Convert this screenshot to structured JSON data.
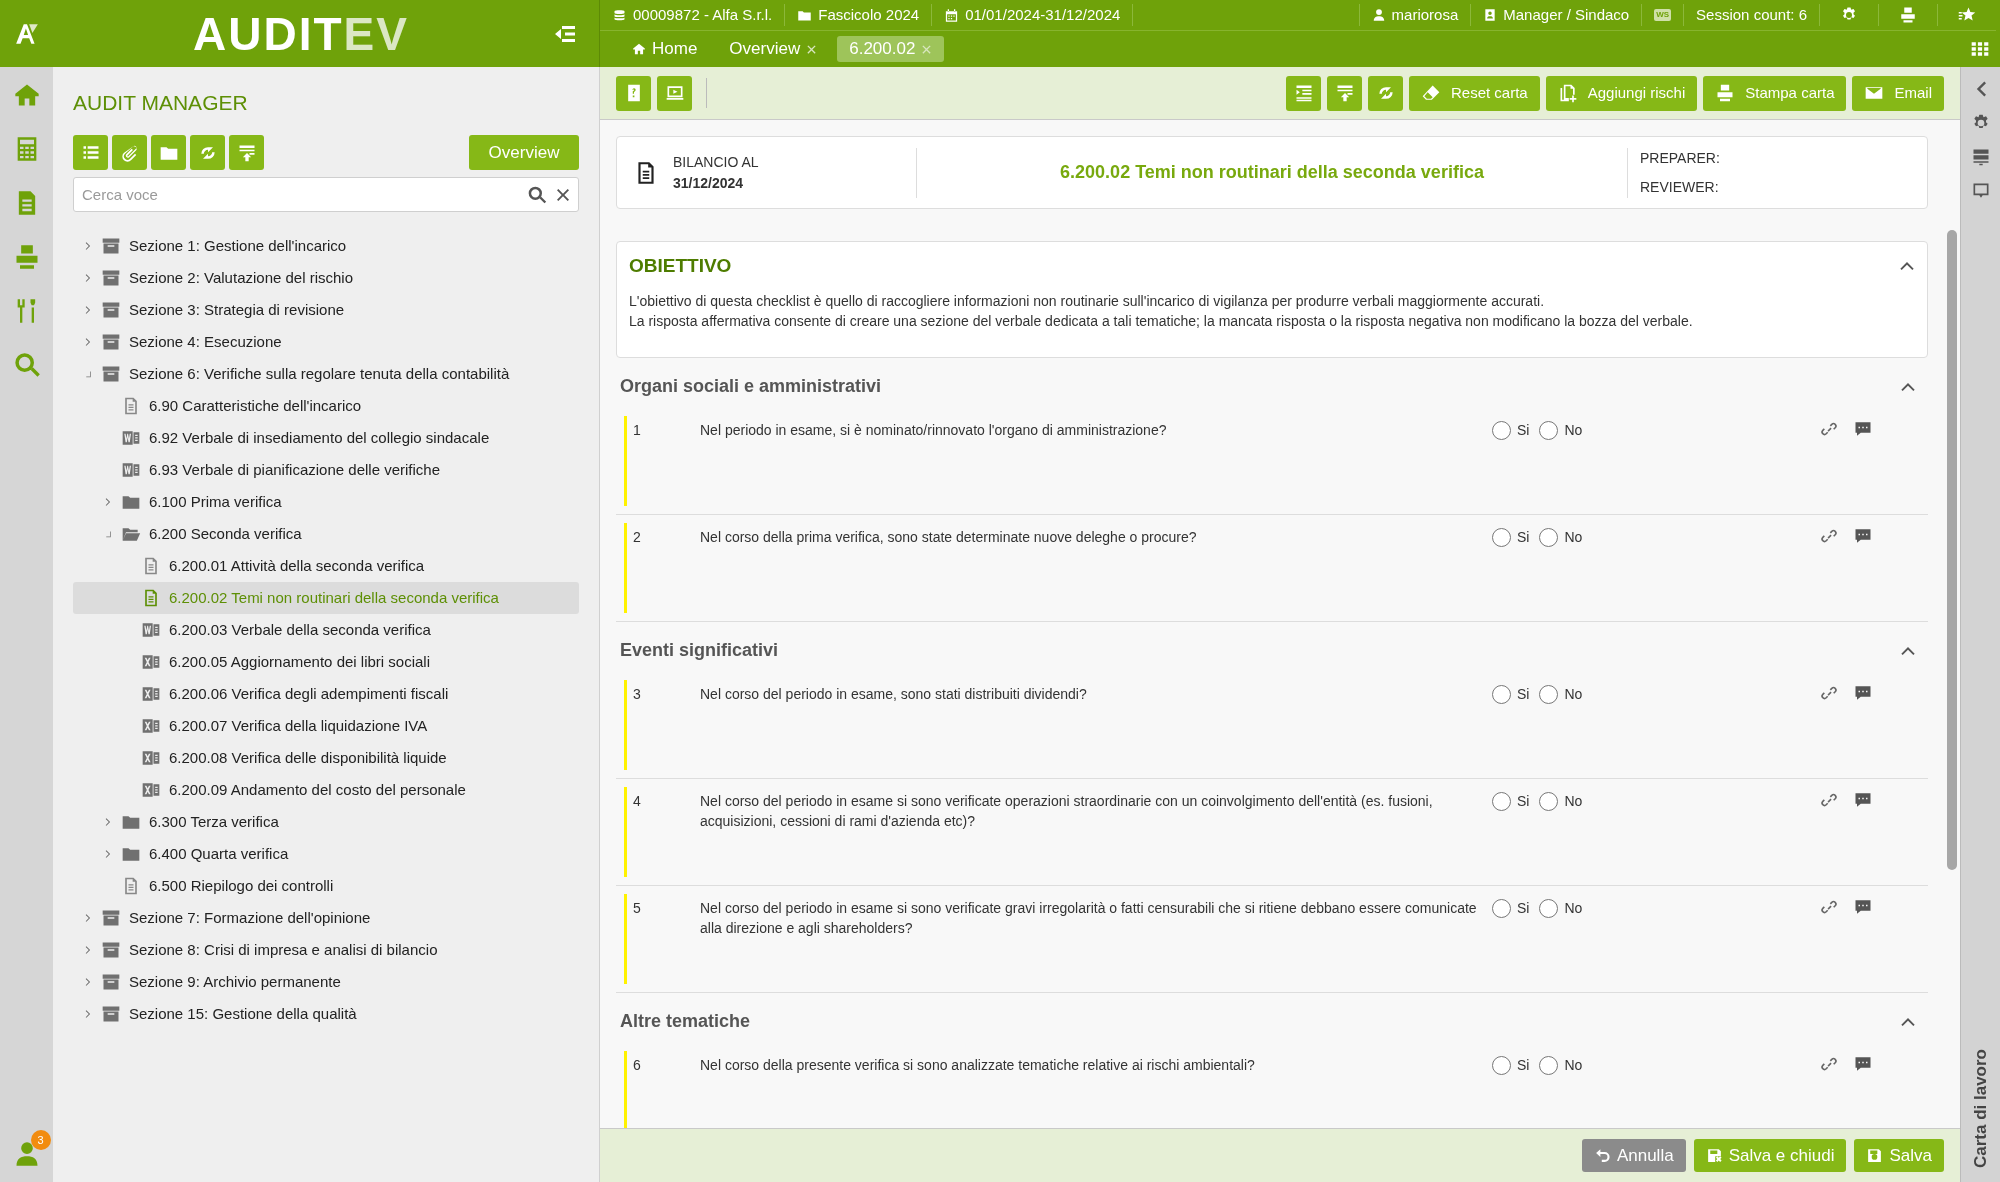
{
  "logo": {
    "main": "AUDIT",
    "accent": "EV"
  },
  "header_info": [
    "00009872 - Alfa S.r.l.",
    "Fascicolo 2024",
    "01/01/2024-31/12/2024"
  ],
  "header_right": [
    {
      "kind": "user",
      "text": "mariorosa"
    },
    {
      "kind": "contact",
      "text": "Manager / Sindaco"
    },
    {
      "kind": "badge",
      "text": "WS"
    },
    {
      "kind": "plain",
      "text": "Session count: 6"
    },
    {
      "kind": "gears"
    },
    {
      "kind": "printer"
    },
    {
      "kind": "star"
    }
  ],
  "tabs": [
    {
      "label": "Home",
      "closable": false,
      "selected": false
    },
    {
      "label": "Overview",
      "closable": true,
      "selected": false
    },
    {
      "label": "6.200.02",
      "closable": true,
      "selected": true
    }
  ],
  "rail_user_badge": "3",
  "sidebar": {
    "title": "AUDIT MANAGER",
    "overview_button": "Overview",
    "search": {
      "placeholder": "Cerca voce"
    },
    "tree": [
      {
        "label": "Sezione 1: Gestione dell'incarico",
        "kind": "section",
        "expanded": false,
        "selected": false
      },
      {
        "label": "Sezione 2: Valutazione del rischio",
        "kind": "section",
        "expanded": false,
        "selected": false
      },
      {
        "label": "Sezione 3: Strategia di revisione",
        "kind": "section",
        "expanded": false,
        "selected": false
      },
      {
        "label": "Sezione 4: Esecuzione",
        "kind": "section",
        "expanded": false,
        "selected": false
      },
      {
        "label": "Sezione 6: Verifiche sulla regolare tenuta della contabilità",
        "kind": "section",
        "expanded": true,
        "selected": false,
        "children": [
          {
            "label": "6.90 Caratteristiche dell'incarico",
            "kind": "doc",
            "selected": false
          },
          {
            "label": "6.92 Verbale di insediamento del collegio sindacale",
            "kind": "word",
            "selected": false
          },
          {
            "label": "6.93 Verbale di pianificazione delle verifiche",
            "kind": "word",
            "selected": false
          },
          {
            "label": "6.100 Prima verifica",
            "kind": "folder",
            "expanded": false,
            "selected": false
          },
          {
            "label": "6.200 Seconda verifica",
            "kind": "folder",
            "expanded": true,
            "selected": false,
            "children": [
              {
                "label": "6.200.01 Attività della seconda verifica",
                "kind": "doc",
                "selected": false
              },
              {
                "label": "6.200.02 Temi non routinari della seconda verifica",
                "kind": "doc",
                "selected": true
              },
              {
                "label": "6.200.03 Verbale della seconda verifica",
                "kind": "word",
                "selected": false
              },
              {
                "label": "6.200.05 Aggiornamento dei libri sociali",
                "kind": "excel",
                "selected": false
              },
              {
                "label": "6.200.06 Verifica degli adempimenti fiscali",
                "kind": "excel",
                "selected": false
              },
              {
                "label": "6.200.07 Verifica della liquidazione IVA",
                "kind": "excel",
                "selected": false
              },
              {
                "label": "6.200.08 Verifica delle disponibilità liquide",
                "kind": "excel",
                "selected": false
              },
              {
                "label": "6.200.09 Andamento del costo del personale",
                "kind": "excel",
                "selected": false
              }
            ]
          },
          {
            "label": "6.300 Terza verifica",
            "kind": "folder",
            "expanded": false,
            "selected": false
          },
          {
            "label": "6.400 Quarta verifica",
            "kind": "folder",
            "expanded": false,
            "selected": false
          },
          {
            "label": "6.500 Riepilogo dei controlli",
            "kind": "doc",
            "selected": false
          }
        ]
      },
      {
        "label": "Sezione 7: Formazione dell'opinione",
        "kind": "section",
        "expanded": false,
        "selected": false
      },
      {
        "label": "Sezione 8: Crisi di impresa e analisi di bilancio",
        "kind": "section",
        "expanded": false,
        "selected": false
      },
      {
        "label": "Sezione 9: Archivio permanente",
        "kind": "section",
        "expanded": false,
        "selected": false
      },
      {
        "label": "Sezione 15: Gestione della qualità",
        "kind": "section",
        "expanded": false,
        "selected": false
      }
    ]
  },
  "toolbar": {
    "buttons": [
      "Reset carta",
      "Aggiungi rischi",
      "Stampa carta",
      "Email"
    ]
  },
  "doc_header": {
    "date_label": "BILANCIO AL",
    "date": "31/12/2024",
    "title": "6.200.02 Temi non routinari della seconda verifica",
    "preparer": "PREPARER:",
    "reviewer": "REVIEWER:"
  },
  "objective": {
    "title": "OBIETTIVO",
    "expanded": true,
    "lines": [
      "L'obiettivo di questa checklist è quello di raccogliere informazioni non routinarie sull'incarico di vigilanza per produrre verbali maggiormente accurati.",
      "La risposta affermativa consente di creare una sezione del verbale dedicata a tali tematiche; la mancata risposta o la risposta negativa non modificano la bozza del verbale."
    ]
  },
  "sections": [
    {
      "title": "Organi sociali e amministrativi",
      "expanded": true,
      "questions": [
        {
          "number": "1",
          "text": "Nel periodo in esame, si è nominato/rinnovato l'organo di amministrazione?",
          "options": [
            {
              "label": "Si",
              "selected": false
            },
            {
              "label": "No",
              "selected": false
            }
          ]
        },
        {
          "number": "2",
          "text": "Nel corso della prima verifica, sono state determinate nuove deleghe o procure?",
          "options": [
            {
              "label": "Si",
              "selected": false
            },
            {
              "label": "No",
              "selected": false
            }
          ]
        }
      ]
    },
    {
      "title": "Eventi significativi",
      "expanded": true,
      "questions": [
        {
          "number": "3",
          "text": "Nel corso del periodo in esame, sono stati distribuiti dividendi?",
          "options": [
            {
              "label": "Si",
              "selected": false
            },
            {
              "label": "No",
              "selected": false
            }
          ]
        },
        {
          "number": "4",
          "text": "Nel corso del periodo in esame si sono verificate operazioni straordinarie con un coinvolgimento dell'entità (es. fusioni, acquisizioni, cessioni di rami d'azienda etc)?",
          "options": [
            {
              "label": "Si",
              "selected": false
            },
            {
              "label": "No",
              "selected": false
            }
          ]
        },
        {
          "number": "5",
          "text": "Nel corso del periodo in esame si sono verificate gravi irregolarità o fatti censurabili che si ritiene debbano essere comunicate alla direzione e agli shareholders?",
          "options": [
            {
              "label": "Si",
              "selected": false
            },
            {
              "label": "No",
              "selected": false
            }
          ]
        }
      ]
    },
    {
      "title": "Altre tematiche",
      "expanded": true,
      "questions": [
        {
          "number": "6",
          "text": "Nel corso della presente verifica si sono analizzate tematiche relative ai rischi ambientali?",
          "options": [
            {
              "label": "Si",
              "selected": false
            },
            {
              "label": "No",
              "selected": false
            }
          ]
        }
      ]
    }
  ],
  "footer_buttons": [
    {
      "kind": "secondary",
      "label": "Annulla"
    },
    {
      "kind": "primary",
      "label": "Salva e chiudi"
    },
    {
      "kind": "primary",
      "label": "Salva"
    }
  ],
  "right_rail": {
    "label": "Carta di lavoro"
  }
}
